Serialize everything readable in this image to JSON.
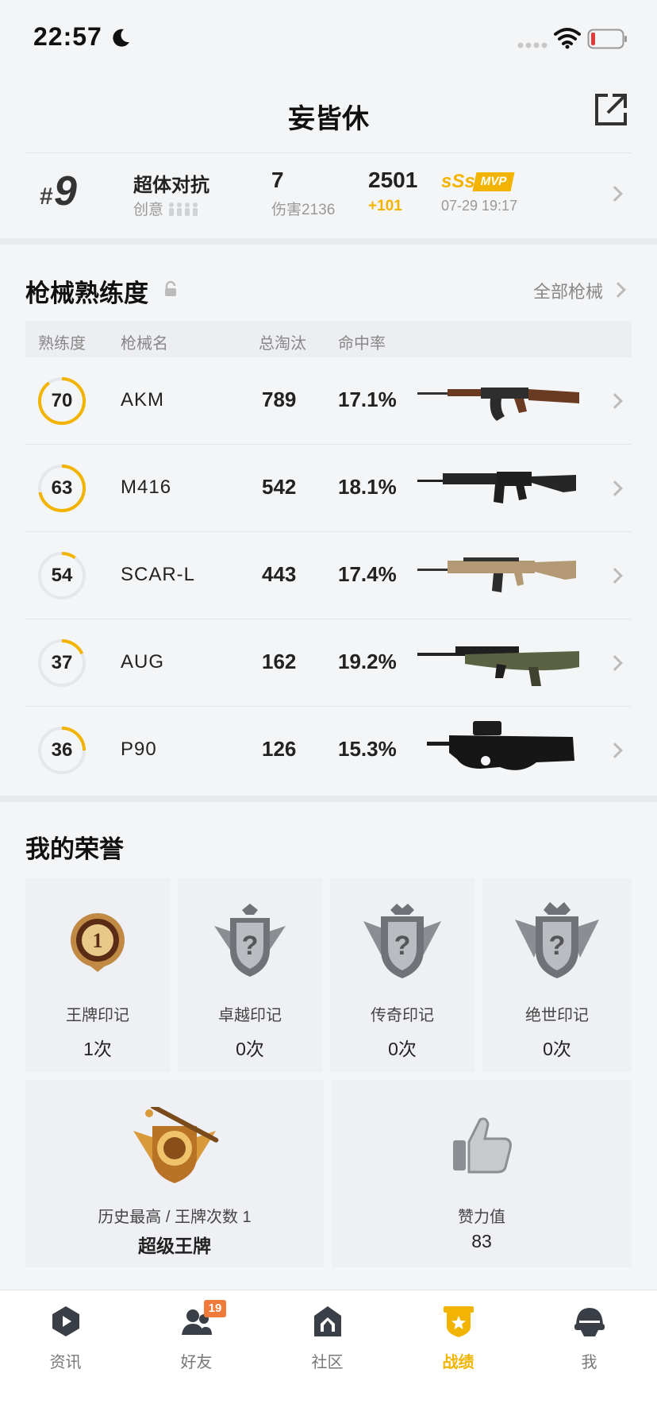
{
  "status_bar": {
    "time": "22:57"
  },
  "header": {
    "title": "妄皆休"
  },
  "match": {
    "rank_hash": "#",
    "rank": "9",
    "mode": "超体对抗",
    "mode_sub": "创意",
    "kills": "7",
    "damage": "伤害2136",
    "score": "2501",
    "score_delta": "+101",
    "grade": "sSs",
    "mvp": "MVP",
    "date": "07-29 19:17"
  },
  "weapons": {
    "title": "枪械熟练度",
    "all_link": "全部枪械",
    "columns": [
      "熟练度",
      "枪械名",
      "总淘汰",
      "命中率"
    ],
    "rows": [
      {
        "proficiency": "70",
        "progress": 0.9,
        "name": "AKM",
        "kills": "789",
        "hit_rate": "17.1%"
      },
      {
        "proficiency": "63",
        "progress": 0.72,
        "name": "M416",
        "kills": "542",
        "hit_rate": "18.1%"
      },
      {
        "proficiency": "54",
        "progress": 0.1,
        "name": "SCAR-L",
        "kills": "443",
        "hit_rate": "17.4%"
      },
      {
        "proficiency": "37",
        "progress": 0.18,
        "name": "AUG",
        "kills": "162",
        "hit_rate": "19.2%"
      },
      {
        "proficiency": "36",
        "progress": 0.25,
        "name": "P90",
        "kills": "126",
        "hit_rate": "15.3%"
      }
    ]
  },
  "honors": {
    "title": "我的荣誉",
    "marks": [
      {
        "label": "王牌印记",
        "count": "1次"
      },
      {
        "label": "卓越印记",
        "count": "0次"
      },
      {
        "label": "传奇印记",
        "count": "0次"
      },
      {
        "label": "绝世印记",
        "count": "0次"
      }
    ],
    "best": {
      "label": "历史最高 / 王牌次数 1",
      "value": "超级王牌"
    },
    "likes": {
      "label": "赞力值",
      "value": "83"
    }
  },
  "tabs": [
    {
      "label": "资讯",
      "icon": "news-icon"
    },
    {
      "label": "好友",
      "icon": "friends-icon",
      "badge": "19"
    },
    {
      "label": "社区",
      "icon": "community-icon"
    },
    {
      "label": "战绩",
      "icon": "record-icon",
      "active": true
    },
    {
      "label": "我",
      "icon": "helmet-icon"
    }
  ],
  "colors": {
    "accent": "#f2b400",
    "background": "#f4f5f7"
  }
}
